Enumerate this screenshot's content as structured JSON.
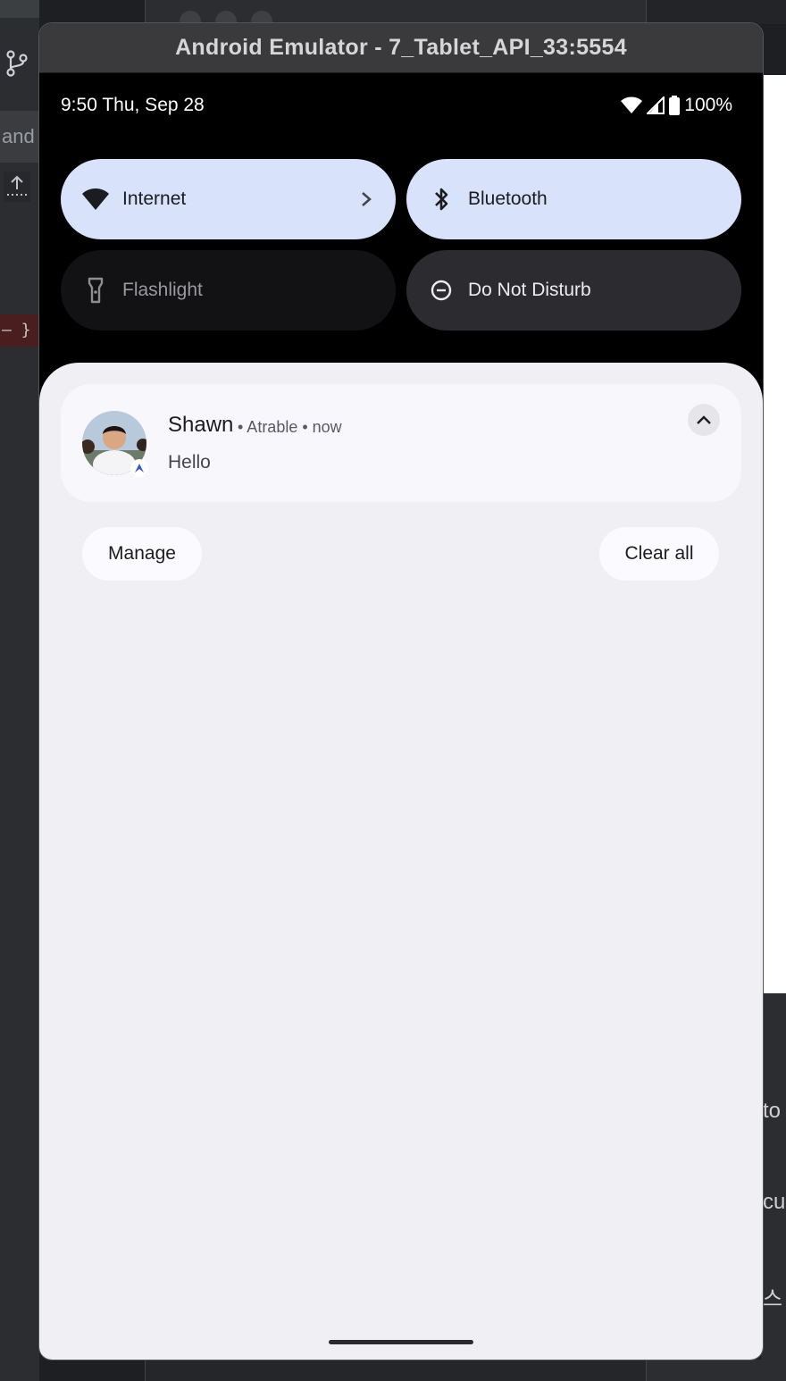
{
  "background": {
    "left_tab_text": "and",
    "left_diff_text": "— }",
    "right_fragments": [
      "to",
      "cu",
      "스"
    ]
  },
  "window": {
    "title": "Android Emulator - 7_Tablet_API_33:5554"
  },
  "status_bar": {
    "time_date": "9:50 Thu, Sep 28",
    "battery": "100%"
  },
  "quick_settings": [
    {
      "label": "Internet",
      "icon": "wifi-icon",
      "state": "on"
    },
    {
      "label": "Bluetooth",
      "icon": "bluetooth-icon",
      "state": "on"
    },
    {
      "label": "Flashlight",
      "icon": "flashlight-icon",
      "state": "unavailable"
    },
    {
      "label": "Do Not Disturb",
      "icon": "do-not-disturb-icon",
      "state": "off"
    }
  ],
  "notification": {
    "sender": "Shawn",
    "app": "Atrable",
    "time": "now",
    "meta": "• Atrable • now",
    "message": "Hello"
  },
  "actions": {
    "manage": "Manage",
    "clear_all": "Clear all"
  },
  "colors": {
    "tile_active": "#d8e2fb",
    "tile_off": "#2c2c30",
    "tile_unavailable": "#121214",
    "shade_bg": "#f0eff4"
  }
}
